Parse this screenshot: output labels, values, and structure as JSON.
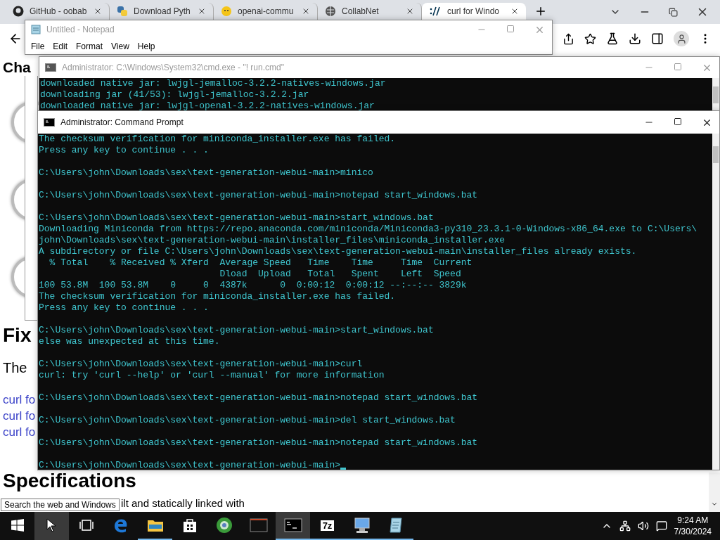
{
  "browser": {
    "tabs": [
      {
        "title": "GitHub - oobab",
        "selected": false
      },
      {
        "title": "Download Pyth",
        "selected": false
      },
      {
        "title": "openai-commu",
        "selected": false
      },
      {
        "title": "CollabNet",
        "selected": false
      },
      {
        "title": "curl for Windo",
        "selected": true
      }
    ],
    "page": [
      {
        "kind": "heading",
        "text": "Cha"
      },
      {
        "kind": "circle"
      },
      {
        "kind": "circle"
      },
      {
        "kind": "circle"
      },
      {
        "kind": "title",
        "text": "Fix"
      },
      {
        "kind": "para",
        "text": "The"
      },
      {
        "kind": "link",
        "text": "curl fo"
      },
      {
        "kind": "link",
        "text": "curl fo"
      },
      {
        "kind": "link",
        "text": "curl fo"
      },
      {
        "kind": "title",
        "text": "Specifications"
      },
      {
        "kind": "tail",
        "text": "ilt and statically linked with"
      }
    ]
  },
  "notepad": {
    "title": "Untitled - Notepad",
    "menu": [
      "File",
      "Edit",
      "Format",
      "View",
      "Help"
    ]
  },
  "back_console": {
    "title": "Administrator: C:\\Windows\\System32\\cmd.exe - \"! run.cmd\"",
    "lines": [
      "downloaded native jar: lwjgl-jemalloc-3.2.2-natives-windows.jar",
      "downloading jar (41/53): lwjgl-jemalloc-3.2.2.jar",
      "downloaded native jar: lwjgl-openal-3.2.2-natives-windows.jar"
    ]
  },
  "console": {
    "title": "Administrator: Command Prompt",
    "blocks": [
      [
        "The checksum verification for miniconda_installer.exe has failed.",
        "Press any key to continue . . ."
      ],
      [
        "C:\\Users\\john\\Downloads\\sex\\text-generation-webui-main>minico"
      ],
      [
        "C:\\Users\\john\\Downloads\\sex\\text-generation-webui-main>notepad start_windows.bat"
      ],
      [
        "C:\\Users\\john\\Downloads\\sex\\text-generation-webui-main>start_windows.bat",
        "Downloading Miniconda from https://repo.anaconda.com/miniconda/Miniconda3-py310_23.3.1-0-Windows-x86_64.exe to C:\\Users\\",
        "john\\Downloads\\sex\\text-generation-webui-main\\installer_files\\miniconda_installer.exe",
        "A subdirectory or file C:\\Users\\john\\Downloads\\sex\\text-generation-webui-main\\installer_files already exists.",
        "  % Total    % Received % Xferd  Average Speed   Time    Time     Time  Current",
        "                                 Dload  Upload   Total   Spent    Left  Speed",
        "100 53.8M  100 53.8M    0     0  4387k      0  0:00:12  0:00:12 --:--:-- 3829k",
        "The checksum verification for miniconda_installer.exe has failed.",
        "Press any key to continue . . ."
      ],
      [
        "C:\\Users\\john\\Downloads\\sex\\text-generation-webui-main>start_windows.bat",
        "else was unexpected at this time."
      ],
      [
        "C:\\Users\\john\\Downloads\\sex\\text-generation-webui-main>curl",
        "curl: try 'curl --help' or 'curl --manual' for more information"
      ],
      [
        "C:\\Users\\john\\Downloads\\sex\\text-generation-webui-main>notepad start_windows.bat"
      ],
      [
        "C:\\Users\\john\\Downloads\\sex\\text-generation-webui-main>del start_windows.bat"
      ],
      [
        "C:\\Users\\john\\Downloads\\sex\\text-generation-webui-main>notepad start_windows.bat"
      ],
      [
        "C:\\Users\\john\\Downloads\\sex\\text-generation-webui-main>"
      ]
    ]
  },
  "tooltip": "Search the web and Windows",
  "taskbar": {
    "items": [
      {
        "kind": "start",
        "running": false,
        "selected": false
      },
      {
        "kind": "search",
        "running": false,
        "selected": true
      },
      {
        "kind": "taskview",
        "running": false,
        "selected": false
      },
      {
        "kind": "edge",
        "running": false,
        "selected": false
      },
      {
        "kind": "explorer",
        "running": true,
        "selected": false
      },
      {
        "kind": "store",
        "running": false,
        "selected": false
      },
      {
        "kind": "orb",
        "running": false,
        "selected": false
      },
      {
        "kind": "window",
        "running": false,
        "selected": false
      },
      {
        "kind": "console",
        "running": true,
        "selected": true
      },
      {
        "kind": "sevenzip",
        "label": "7z",
        "running": true,
        "selected": false
      },
      {
        "kind": "computer",
        "running": true,
        "selected": false
      },
      {
        "kind": "notes",
        "running": true,
        "selected": false
      }
    ],
    "time": "9:24 AM",
    "date": "7/30/2024"
  }
}
